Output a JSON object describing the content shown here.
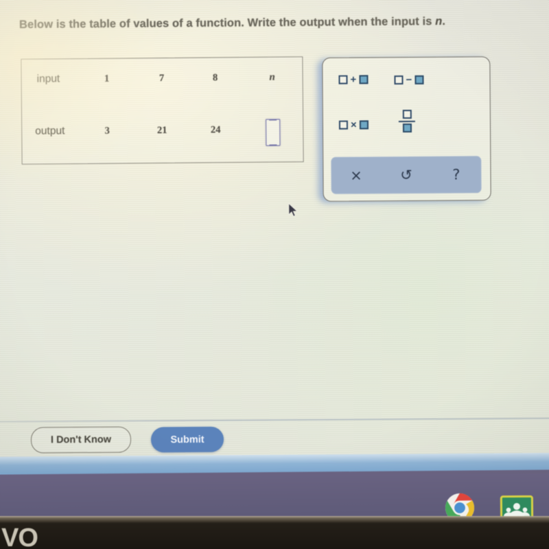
{
  "prompt": {
    "text_before": "Below is the table of values of a function. Write the output when the input is ",
    "variable": "n",
    "text_after": "."
  },
  "table": {
    "row_labels": [
      "input",
      "output"
    ],
    "input_values": [
      "1",
      "7",
      "8",
      "n"
    ],
    "output_values": [
      "3",
      "21",
      "24",
      ""
    ],
    "answer_field": {
      "name": "output-answer-box",
      "value": "",
      "placeholder": ""
    }
  },
  "keypad": {
    "operations": [
      {
        "name": "addition",
        "symbol": "+",
        "label": "□+□"
      },
      {
        "name": "subtraction",
        "symbol": "−",
        "label": "□−□"
      },
      {
        "name": "multiplication",
        "symbol": "×",
        "label": "□×□"
      },
      {
        "name": "fraction",
        "symbol": "/",
        "label": "□/□"
      }
    ],
    "controls": [
      {
        "name": "clear",
        "glyph": "×"
      },
      {
        "name": "undo",
        "glyph": "↺"
      },
      {
        "name": "help",
        "glyph": "?"
      }
    ]
  },
  "footer": {
    "dont_know_label": "I Don't Know",
    "submit_label": "Submit"
  },
  "taskbar": {
    "icons": [
      {
        "name": "chrome-icon",
        "label": "Google Chrome"
      },
      {
        "name": "classroom-icon",
        "label": "Google Classroom"
      }
    ]
  },
  "watermark": {
    "text": "VO"
  },
  "colors": {
    "submit_blue": "#5b83bb",
    "answer_box_outline": "#6f6fa6",
    "keypad_square_filled": "#6fa8c4",
    "keypad_square_border": "#2f4a68",
    "keypad_bar": "#9fb1ca",
    "taskbar": "#635e7c",
    "page_background": "#eaeade"
  }
}
